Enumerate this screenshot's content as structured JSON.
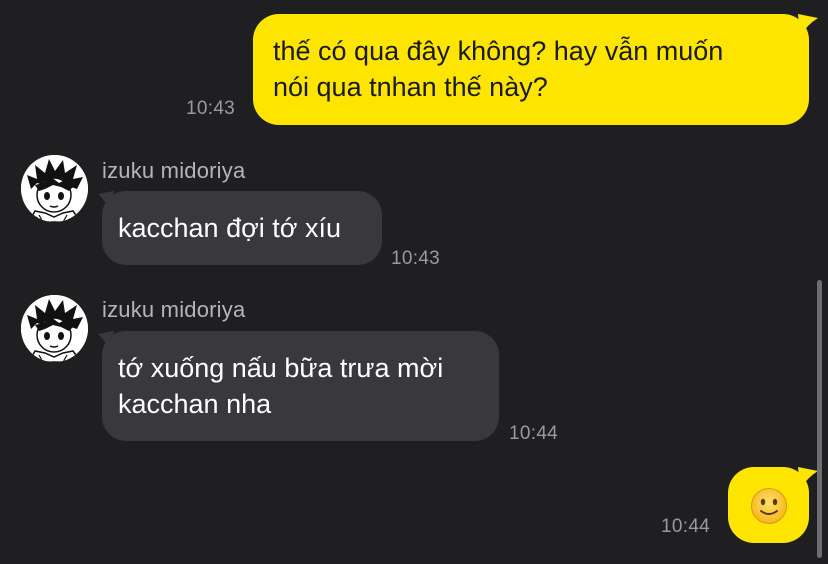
{
  "messages": [
    {
      "direction": "outgoing",
      "text": "thế có qua đây không? hay vẫn muốn\nnói qua tnhan thế này?",
      "time": "10:43"
    },
    {
      "direction": "incoming",
      "sender": "izuku midoriya",
      "text": "kacchan đợi tớ xíu",
      "time": "10:43"
    },
    {
      "direction": "incoming",
      "sender": "izuku midoriya",
      "text": "tớ xuống nấu bữa trưa mời\nkacchan nha",
      "time": "10:44"
    },
    {
      "direction": "outgoing",
      "emoji": "slightly-smiling-face",
      "time": "10:44"
    }
  ],
  "colors": {
    "background": "#1f1f21",
    "outgoing_bubble": "#fee500",
    "incoming_bubble": "#39393c",
    "timestamp": "#9a9a9d",
    "sender_name": "#b5b5b8"
  }
}
